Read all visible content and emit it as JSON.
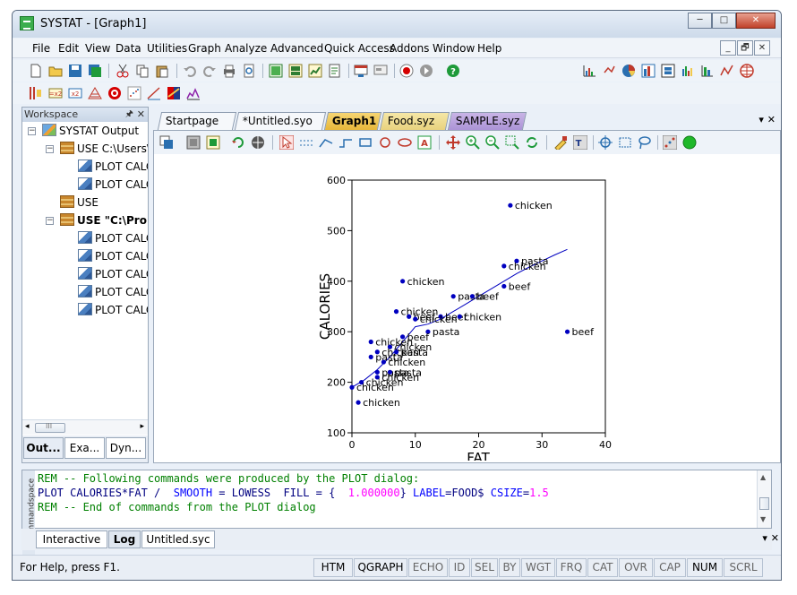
{
  "window": {
    "title": "SYSTAT - [Graph1]",
    "min": "─",
    "max": "□",
    "close": "✕"
  },
  "menubar": {
    "items": [
      "File",
      "Edit",
      "View",
      "Data",
      "Utilities",
      "Graph",
      "Analyze",
      "Advanced",
      "Quick Access",
      "Addons",
      "Window",
      "Help"
    ],
    "mdi": [
      "_",
      "🗗",
      "✕"
    ]
  },
  "workspace": {
    "header": "Workspace",
    "pin": "🖈",
    "close": "✕",
    "tree": [
      {
        "label": "SYSTAT Output",
        "icon": "output-icon",
        "bold": false
      },
      {
        "label": "USE C:\\Users\\",
        "icon": "use-icon",
        "bold": false
      },
      {
        "label": "PLOT CALORIES",
        "icon": "plot-icon",
        "bold": false
      },
      {
        "label": "PLOT CALORIES",
        "icon": "plot-icon",
        "bold": false
      },
      {
        "label": "USE",
        "icon": "use-icon",
        "bold": false
      },
      {
        "label": "USE \"C:\\Pro",
        "icon": "use-icon",
        "bold": true
      },
      {
        "label": "PLOT CALORIES",
        "icon": "plot-icon",
        "bold": false
      },
      {
        "label": "PLOT CALORIES",
        "icon": "plot-icon",
        "bold": false
      },
      {
        "label": "PLOT CALORIES",
        "icon": "plot-icon",
        "bold": false
      },
      {
        "label": "PLOT CALORIES",
        "icon": "plot-icon",
        "bold": false
      },
      {
        "label": "PLOT CALORIES",
        "icon": "plot-icon",
        "bold": false
      }
    ],
    "scroll_left": "◂",
    "scroll_right": "▸",
    "scroll_grip": "III",
    "tabs": [
      "Out...",
      "Exa...",
      "Dyn..."
    ]
  },
  "doc_tabs": [
    "Startpage",
    "*Untitled.syo",
    "Graph1",
    "Food.syz",
    "SAMPLE.syz"
  ],
  "doc_tab_controls": "▾ ✕",
  "chart_data": {
    "type": "scatter",
    "xlabel": "FAT",
    "ylabel": "CALORIES",
    "xlim": [
      0,
      40
    ],
    "ylim": [
      100,
      600
    ],
    "xticks": [
      0,
      10,
      20,
      30,
      40
    ],
    "yticks": [
      100,
      200,
      300,
      400,
      500,
      600
    ],
    "marker_color": "#0000c0",
    "points": [
      {
        "x": 25,
        "y": 550,
        "label": "chicken"
      },
      {
        "x": 26,
        "y": 440,
        "label": "pasta"
      },
      {
        "x": 24,
        "y": 430,
        "label": "chicken"
      },
      {
        "x": 8,
        "y": 400,
        "label": "chicken"
      },
      {
        "x": 24,
        "y": 390,
        "label": "beef"
      },
      {
        "x": 16,
        "y": 370,
        "label": "pasta"
      },
      {
        "x": 19,
        "y": 370,
        "label": "beef"
      },
      {
        "x": 7,
        "y": 340,
        "label": "chicken"
      },
      {
        "x": 9,
        "y": 330,
        "label": "beef"
      },
      {
        "x": 14,
        "y": 330,
        "label": "beef"
      },
      {
        "x": 17,
        "y": 330,
        "label": "chicken"
      },
      {
        "x": 10,
        "y": 325,
        "label": "chicken"
      },
      {
        "x": 34,
        "y": 300,
        "label": "beef"
      },
      {
        "x": 12,
        "y": 300,
        "label": "pasta"
      },
      {
        "x": 8,
        "y": 290,
        "label": "beef"
      },
      {
        "x": 3,
        "y": 280,
        "label": "chicken"
      },
      {
        "x": 6,
        "y": 270,
        "label": "chicken"
      },
      {
        "x": 4,
        "y": 260,
        "label": "chicken"
      },
      {
        "x": 7,
        "y": 260,
        "label": "pasta"
      },
      {
        "x": 3,
        "y": 250,
        "label": "pasta"
      },
      {
        "x": 5,
        "y": 240,
        "label": "chicken"
      },
      {
        "x": 4,
        "y": 220,
        "label": "pasta"
      },
      {
        "x": 6,
        "y": 220,
        "label": "pasta"
      },
      {
        "x": 4,
        "y": 210,
        "label": "chicken"
      },
      {
        "x": 1.5,
        "y": 200,
        "label": "chicken"
      },
      {
        "x": 0,
        "y": 190,
        "label": "chicken"
      },
      {
        "x": 1,
        "y": 160,
        "label": "chicken"
      }
    ],
    "smooth": {
      "method": "LOWESS",
      "x": [
        0,
        2,
        4,
        6,
        8,
        10,
        12,
        14,
        16,
        18,
        20,
        22,
        24,
        26,
        28,
        30,
        32,
        34
      ],
      "y": [
        190,
        205,
        225,
        250,
        280,
        310,
        315,
        325,
        340,
        355,
        370,
        385,
        400,
        415,
        428,
        440,
        452,
        463
      ]
    }
  },
  "command": {
    "side_label": "Commandspace",
    "lines": [
      {
        "text": "REM -- Following commands were produced by the PLOT dialog:",
        "color": "#008000"
      },
      {
        "parts": [
          {
            "text": "PLOT CALORIES*FAT /  ",
            "color": "#000080"
          },
          {
            "text": "SMOOTH",
            "color": "#0000ff"
          },
          {
            "text": " = LOWESS  FILL = {  ",
            "color": "#000080"
          },
          {
            "text": "1.000000",
            "color": "#ff00ff"
          },
          {
            "text": "} ",
            "color": "#000080"
          },
          {
            "text": "LABEL",
            "color": "#0000ff"
          },
          {
            "text": "=FOOD$ ",
            "color": "#000080"
          },
          {
            "text": "CSIZE",
            "color": "#0000ff"
          },
          {
            "text": "=",
            "color": "#000080"
          },
          {
            "text": "1.5",
            "color": "#ff00ff"
          }
        ]
      },
      {
        "text": "REM -- End of commands from the PLOT dialog",
        "color": "#008000"
      }
    ],
    "scroll_up": "▲",
    "scroll_down": "▼",
    "tabs": [
      "Interactive",
      "Log",
      "Untitled.syc"
    ],
    "tab_controls": "▾ ✕"
  },
  "status": {
    "help": "For Help, press F1.",
    "cells": [
      "HTM",
      "QGRAPH",
      "ECHO",
      "ID",
      "SEL",
      "BY",
      "WGT",
      "FRQ",
      "CAT",
      "OVR",
      "CAP",
      "NUM",
      "SCRL"
    ],
    "active": [
      "HTM",
      "QGRAPH",
      "NUM"
    ]
  }
}
